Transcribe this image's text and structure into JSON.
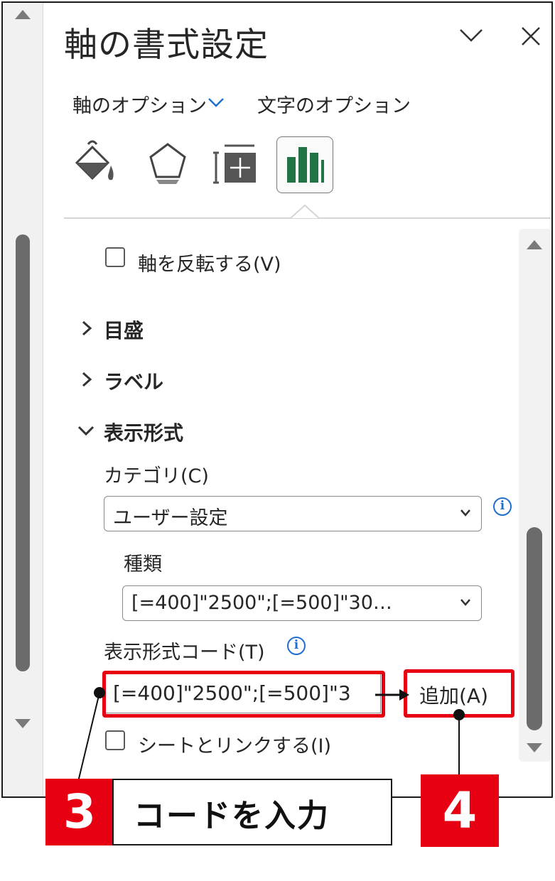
{
  "panel": {
    "title": "軸の書式設定",
    "tabs": {
      "axis_options": "軸のオプション",
      "text_options": "文字のオプション"
    },
    "icons": [
      "fill-line-icon",
      "effects-icon",
      "size-properties-icon",
      "axis-options-icon"
    ]
  },
  "options": {
    "reverse_axis": "軸を反転する(V)",
    "reverse_axis_checked": false,
    "sections": {
      "tick_marks": "目盛",
      "labels": "ラベル",
      "number": "表示形式"
    },
    "category_label": "カテゴリ(C)",
    "category_value": "ユーザー設定",
    "type_label": "種類",
    "type_value": "[=400]\"2500\";[=500]\"30…",
    "format_code_label": "表示形式コード(T)",
    "format_code_value": "[=400]\"2500\";[=500]\"3",
    "add_button": "追加(A)",
    "link_to_source": "シートとリンクする(I)",
    "link_to_source_checked": false
  },
  "annotations": {
    "step3_number": "3",
    "step3_text": "コードを入力",
    "step4_number": "4",
    "highlight_color": "#e60012"
  }
}
